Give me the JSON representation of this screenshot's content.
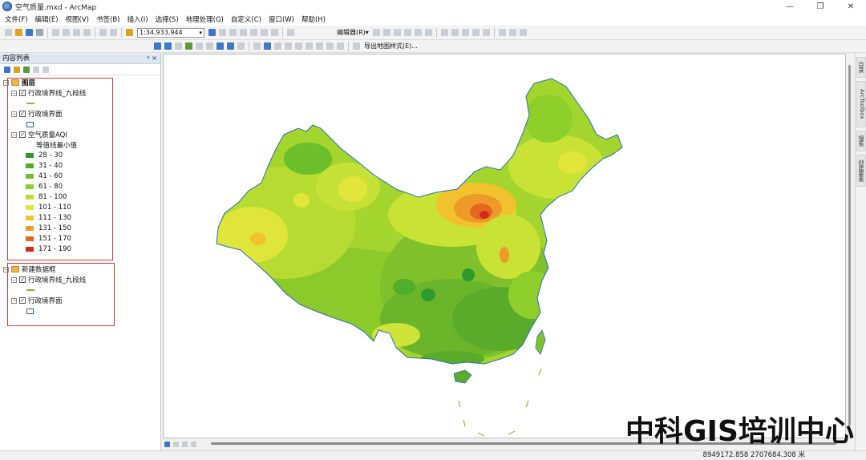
{
  "window": {
    "title": "空气质量.mxd - ArcMap",
    "min": "—",
    "max": "❐",
    "close": "✕"
  },
  "menu": [
    "文件(F)",
    "编辑(E)",
    "视图(V)",
    "书签(B)",
    "插入(I)",
    "选择(S)",
    "地理处理(G)",
    "自定义(C)",
    "窗口(W)",
    "帮助(H)"
  ],
  "toolbar": {
    "scale": "1:34,933,944",
    "editor": "编辑器(R)▾",
    "export_style": "导出地图样式(E)..."
  },
  "toc": {
    "title": "内容列表",
    "pin": "ᵖ ×",
    "frame1": {
      "name": "图层",
      "layer1": "行政境界线_九段线",
      "layer2": "行政境界面",
      "layer3": "空气质量AQI",
      "field": "等值线最小值",
      "classes": [
        {
          "label": "28 - 30",
          "color": "#2e9a2e"
        },
        {
          "label": "31 - 40",
          "color": "#4fae2c"
        },
        {
          "label": "41 - 60",
          "color": "#6cbf2a"
        },
        {
          "label": "61 - 80",
          "color": "#8fcf2c"
        },
        {
          "label": "81 - 100",
          "color": "#b9de33"
        },
        {
          "label": "101 - 110",
          "color": "#e3e63a"
        },
        {
          "label": "111 - 130",
          "color": "#f2c22e"
        },
        {
          "label": "131 - 150",
          "color": "#ee9a26"
        },
        {
          "label": "151 - 170",
          "color": "#e5661f"
        },
        {
          "label": "171 - 190",
          "color": "#d42a1c"
        }
      ]
    },
    "frame2": {
      "name": "新建数据框",
      "layer1": "行政境界线_九段线",
      "layer2": "行政境界面"
    }
  },
  "sidebar_tabs": [
    "目录",
    "ArcToolbox",
    "搜索",
    "创建要素"
  ],
  "status": {
    "coords": "8949172.858  2707684.308 米"
  },
  "watermark": "中科GIS培训中心"
}
